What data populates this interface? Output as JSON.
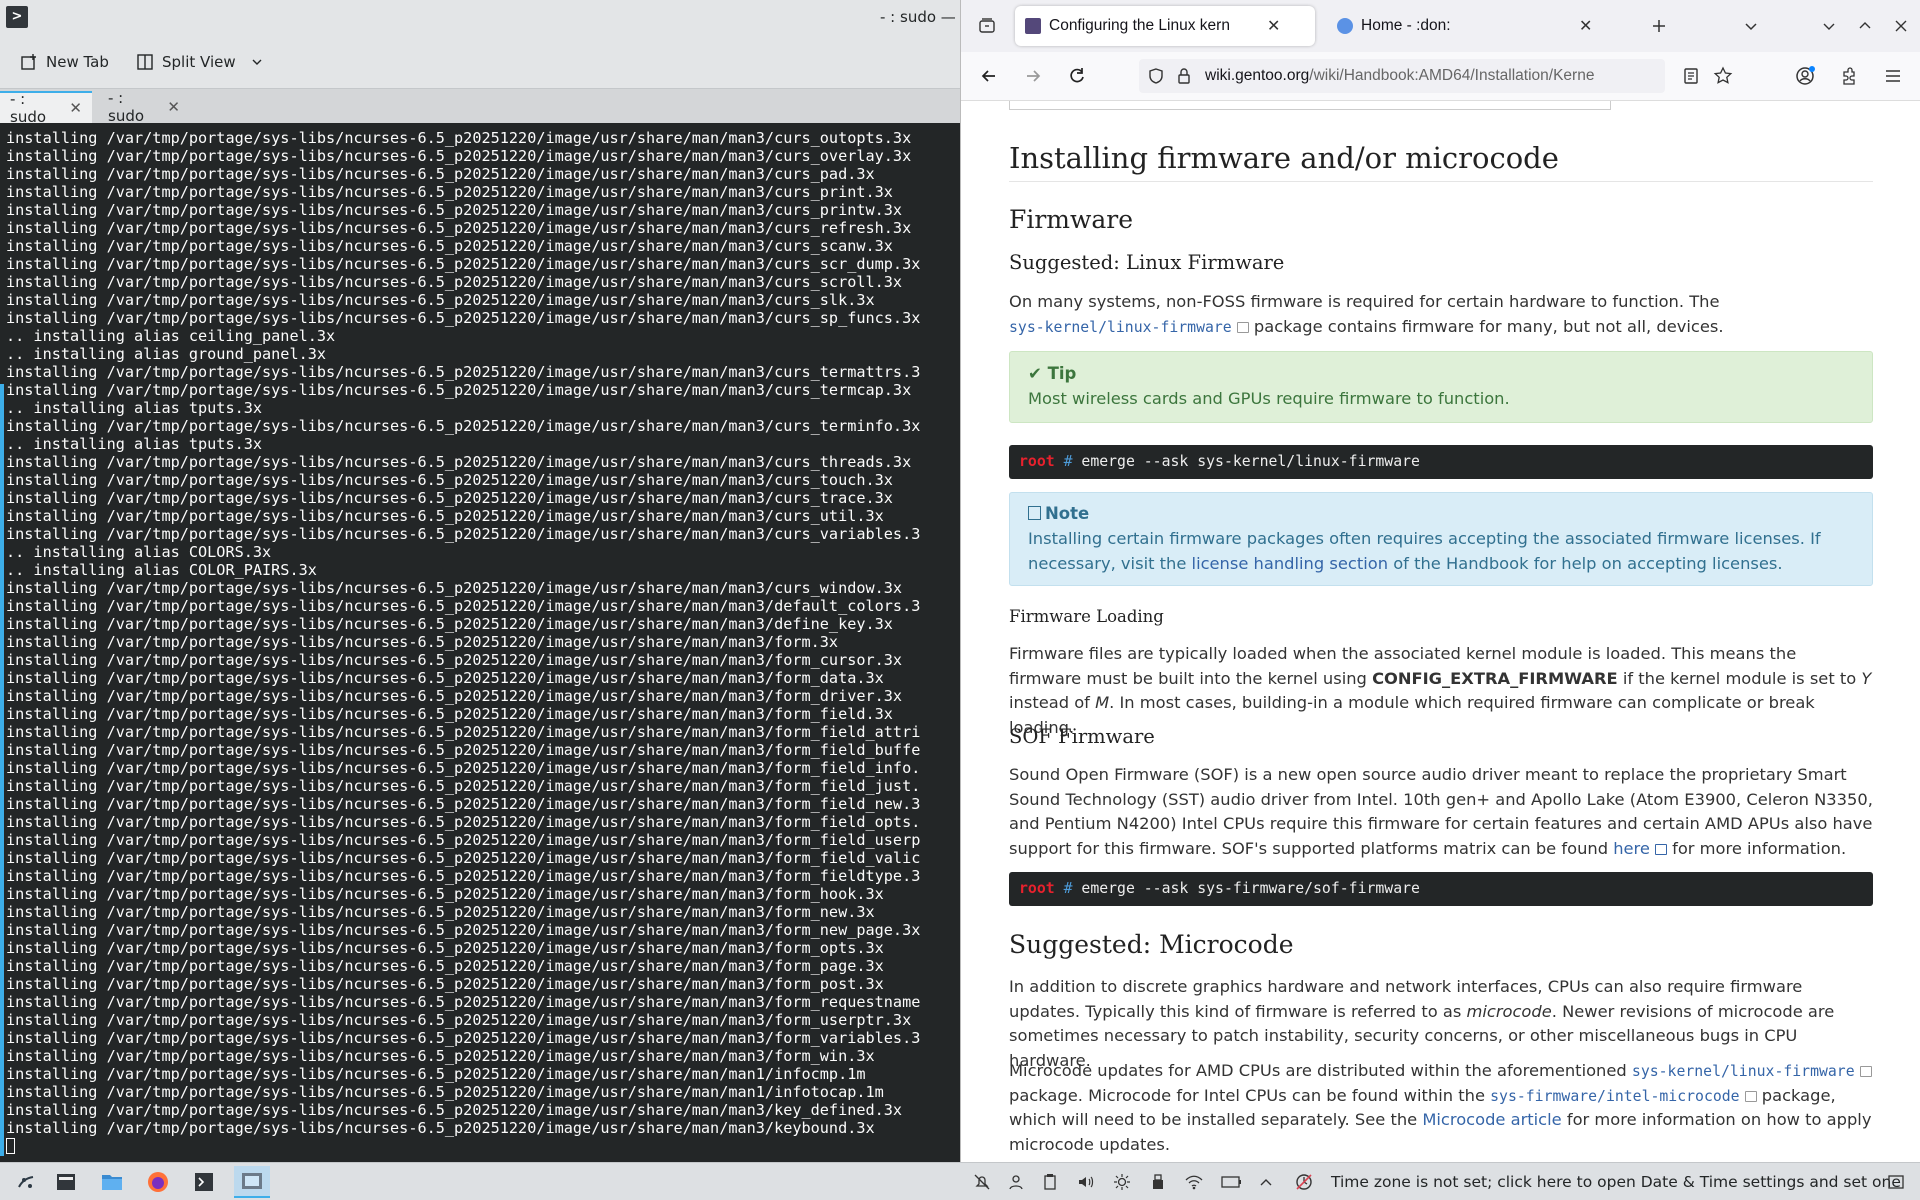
{
  "konsole": {
    "window_title": "- : sudo —",
    "new_tab_label": "New Tab",
    "split_view_label": "Split View",
    "tabs": [
      {
        "label": "- : sudo"
      },
      {
        "label": "- : sudo"
      }
    ],
    "terminal_lines": [
      "installing /var/tmp/portage/sys-libs/ncurses-6.5_p20251220/image/usr/share/man/man3/curs_outopts.3x",
      "installing /var/tmp/portage/sys-libs/ncurses-6.5_p20251220/image/usr/share/man/man3/curs_overlay.3x",
      "installing /var/tmp/portage/sys-libs/ncurses-6.5_p20251220/image/usr/share/man/man3/curs_pad.3x",
      "installing /var/tmp/portage/sys-libs/ncurses-6.5_p20251220/image/usr/share/man/man3/curs_print.3x",
      "installing /var/tmp/portage/sys-libs/ncurses-6.5_p20251220/image/usr/share/man/man3/curs_printw.3x",
      "installing /var/tmp/portage/sys-libs/ncurses-6.5_p20251220/image/usr/share/man/man3/curs_refresh.3x",
      "installing /var/tmp/portage/sys-libs/ncurses-6.5_p20251220/image/usr/share/man/man3/curs_scanw.3x",
      "installing /var/tmp/portage/sys-libs/ncurses-6.5_p20251220/image/usr/share/man/man3/curs_scr_dump.3x",
      "installing /var/tmp/portage/sys-libs/ncurses-6.5_p20251220/image/usr/share/man/man3/curs_scroll.3x",
      "installing /var/tmp/portage/sys-libs/ncurses-6.5_p20251220/image/usr/share/man/man3/curs_slk.3x",
      "installing /var/tmp/portage/sys-libs/ncurses-6.5_p20251220/image/usr/share/man/man3/curs_sp_funcs.3x",
      ".. installing alias ceiling_panel.3x",
      ".. installing alias ground_panel.3x",
      "installing /var/tmp/portage/sys-libs/ncurses-6.5_p20251220/image/usr/share/man/man3/curs_termattrs.3",
      "installing /var/tmp/portage/sys-libs/ncurses-6.5_p20251220/image/usr/share/man/man3/curs_termcap.3x",
      ".. installing alias tputs.3x",
      "installing /var/tmp/portage/sys-libs/ncurses-6.5_p20251220/image/usr/share/man/man3/curs_terminfo.3x",
      ".. installing alias tputs.3x",
      "installing /var/tmp/portage/sys-libs/ncurses-6.5_p20251220/image/usr/share/man/man3/curs_threads.3x",
      "installing /var/tmp/portage/sys-libs/ncurses-6.5_p20251220/image/usr/share/man/man3/curs_touch.3x",
      "installing /var/tmp/portage/sys-libs/ncurses-6.5_p20251220/image/usr/share/man/man3/curs_trace.3x",
      "installing /var/tmp/portage/sys-libs/ncurses-6.5_p20251220/image/usr/share/man/man3/curs_util.3x",
      "installing /var/tmp/portage/sys-libs/ncurses-6.5_p20251220/image/usr/share/man/man3/curs_variables.3",
      ".. installing alias COLORS.3x",
      ".. installing alias COLOR_PAIRS.3x",
      "installing /var/tmp/portage/sys-libs/ncurses-6.5_p20251220/image/usr/share/man/man3/curs_window.3x",
      "installing /var/tmp/portage/sys-libs/ncurses-6.5_p20251220/image/usr/share/man/man3/default_colors.3",
      "installing /var/tmp/portage/sys-libs/ncurses-6.5_p20251220/image/usr/share/man/man3/define_key.3x",
      "installing /var/tmp/portage/sys-libs/ncurses-6.5_p20251220/image/usr/share/man/man3/form.3x",
      "installing /var/tmp/portage/sys-libs/ncurses-6.5_p20251220/image/usr/share/man/man3/form_cursor.3x",
      "installing /var/tmp/portage/sys-libs/ncurses-6.5_p20251220/image/usr/share/man/man3/form_data.3x",
      "installing /var/tmp/portage/sys-libs/ncurses-6.5_p20251220/image/usr/share/man/man3/form_driver.3x",
      "installing /var/tmp/portage/sys-libs/ncurses-6.5_p20251220/image/usr/share/man/man3/form_field.3x",
      "installing /var/tmp/portage/sys-libs/ncurses-6.5_p20251220/image/usr/share/man/man3/form_field_attri",
      "installing /var/tmp/portage/sys-libs/ncurses-6.5_p20251220/image/usr/share/man/man3/form_field_buffe",
      "installing /var/tmp/portage/sys-libs/ncurses-6.5_p20251220/image/usr/share/man/man3/form_field_info.",
      "installing /var/tmp/portage/sys-libs/ncurses-6.5_p20251220/image/usr/share/man/man3/form_field_just.",
      "installing /var/tmp/portage/sys-libs/ncurses-6.5_p20251220/image/usr/share/man/man3/form_field_new.3",
      "installing /var/tmp/portage/sys-libs/ncurses-6.5_p20251220/image/usr/share/man/man3/form_field_opts.",
      "installing /var/tmp/portage/sys-libs/ncurses-6.5_p20251220/image/usr/share/man/man3/form_field_userp",
      "installing /var/tmp/portage/sys-libs/ncurses-6.5_p20251220/image/usr/share/man/man3/form_field_valic",
      "installing /var/tmp/portage/sys-libs/ncurses-6.5_p20251220/image/usr/share/man/man3/form_fieldtype.3",
      "installing /var/tmp/portage/sys-libs/ncurses-6.5_p20251220/image/usr/share/man/man3/form_hook.3x",
      "installing /var/tmp/portage/sys-libs/ncurses-6.5_p20251220/image/usr/share/man/man3/form_new.3x",
      "installing /var/tmp/portage/sys-libs/ncurses-6.5_p20251220/image/usr/share/man/man3/form_new_page.3x",
      "installing /var/tmp/portage/sys-libs/ncurses-6.5_p20251220/image/usr/share/man/man3/form_opts.3x",
      "installing /var/tmp/portage/sys-libs/ncurses-6.5_p20251220/image/usr/share/man/man3/form_page.3x",
      "installing /var/tmp/portage/sys-libs/ncurses-6.5_p20251220/image/usr/share/man/man3/form_post.3x",
      "installing /var/tmp/portage/sys-libs/ncurses-6.5_p20251220/image/usr/share/man/man3/form_requestname",
      "installing /var/tmp/portage/sys-libs/ncurses-6.5_p20251220/image/usr/share/man/man3/form_userptr.3x",
      "installing /var/tmp/portage/sys-libs/ncurses-6.5_p20251220/image/usr/share/man/man3/form_variables.3",
      "installing /var/tmp/portage/sys-libs/ncurses-6.5_p20251220/image/usr/share/man/man3/form_win.3x",
      "installing /var/tmp/portage/sys-libs/ncurses-6.5_p20251220/image/usr/share/man/man1/infocmp.1m",
      "installing /var/tmp/portage/sys-libs/ncurses-6.5_p20251220/image/usr/share/man/man1/infotocap.1m",
      "installing /var/tmp/portage/sys-libs/ncurses-6.5_p20251220/image/usr/share/man/man3/key_defined.3x",
      "installing /var/tmp/portage/sys-libs/ncurses-6.5_p20251220/image/usr/share/man/man3/keybound.3x"
    ]
  },
  "firefox": {
    "tabs": [
      {
        "title": "Configuring the Linux kern",
        "active": true
      },
      {
        "title": "Home - :don:",
        "active": false
      }
    ],
    "url_host": "wiki.gentoo.org",
    "url_path": "/wiki/Handbook:AMD64/Installation/Kerne"
  },
  "page": {
    "h1": "Installing firmware and/or microcode",
    "firmware_h2": "Firmware",
    "linux_fw_h3": "Suggested: Linux Firmware",
    "p1_a": "On many systems, non-FOSS firmware is required for certain hardware to function. The",
    "p1_code": "sys-kernel/linux-firmware",
    "p1_b": " package contains firmware for many, but not all, devices.",
    "tip_title": "Tip",
    "tip_body": "Most wireless cards and GPUs require firmware to function.",
    "cmd1_prompt": "root",
    "cmd1_hash": "#",
    "cmd1_text": "emerge --ask sys-kernel/linux-firmware",
    "note_title": "Note",
    "note_body_a": "Installing certain firmware packages often requires accepting the associated firmware licenses. If necessary, visit the ",
    "note_link": "license handling section",
    "note_body_b": " of the Handbook for help on accepting licenses.",
    "fw_loading_h4": "Firmware Loading",
    "fw_loading_a": "Firmware files are typically loaded when the associated kernel module is loaded. This means the firmware must be built into the kernel using ",
    "fw_loading_bold": "CONFIG_EXTRA_FIRMWARE",
    "fw_loading_b": " if the kernel module is set to ",
    "fw_loading_y": "Y",
    "fw_loading_c": " instead of ",
    "fw_loading_m": "M",
    "fw_loading_d": ". In most cases, building-in a module which required firmware can complicate or break loading.",
    "sof_h3": "SOF Firmware",
    "sof_a": "Sound Open Firmware (SOF) is a new open source audio driver meant to replace the proprietary Smart Sound Technology (SST) audio driver from Intel. 10th gen+ and Apollo Lake (Atom E3900, Celeron N3350, and Pentium N4200) Intel CPUs require this firmware for certain features and certain AMD APUs also have support for this firmware. SOF's supported platforms matrix can be found ",
    "sof_link": "here",
    "sof_b": " for more information.",
    "cmd2_prompt": "root",
    "cmd2_hash": "#",
    "cmd2_text": "emerge --ask sys-firmware/sof-firmware",
    "microcode_h2": "Suggested: Microcode",
    "mc_p1_a": "In addition to discrete graphics hardware and network interfaces, CPUs can also require firmware updates. Typically this kind of firmware is referred to as ",
    "mc_p1_em": "microcode",
    "mc_p1_b": ". Newer revisions of microcode are sometimes necessary to patch instability, security concerns, or other miscellaneous bugs in CPU hardware.",
    "mc_p2_a": "Microcode updates for AMD CPUs are distributed within the aforementioned ",
    "mc_p2_code1": "sys-kernel/linux-firmware",
    "mc_p2_b": " package. Microcode for Intel CPUs can be found within the ",
    "mc_p2_code2": "sys-firmware/intel-microcode",
    "mc_p2_c": " package, which will need to be installed separately. See the ",
    "mc_p2_link": "Microcode article",
    "mc_p2_d": " for more information on how to apply microcode updates."
  },
  "taskbar": {
    "tray_message": "Time zone is not set; click here to open Date & Time settings and set one"
  },
  "colors": {
    "konsole_bg": "#232627",
    "accent_blue": "#3daee9",
    "tip_bg": "#dff0d8",
    "note_bg": "#d9edf7",
    "link": "#3565a8",
    "prompt_root": "#e8212d"
  }
}
